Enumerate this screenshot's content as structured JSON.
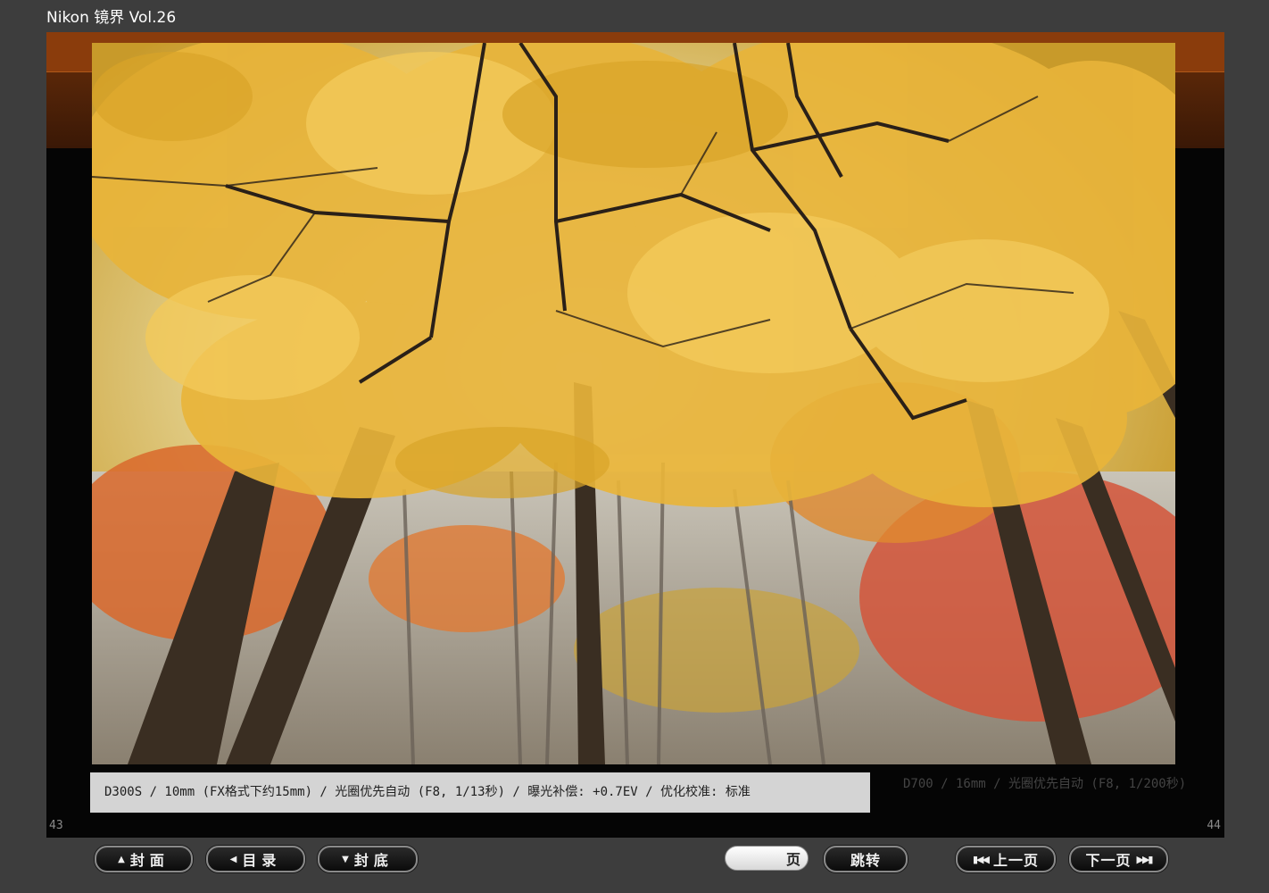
{
  "app": {
    "title": "Nikon 镜界 Vol.26"
  },
  "pages": {
    "left_number": "43",
    "right_number": "44"
  },
  "photo": {
    "subject": "autumn maple canopy",
    "caption": "D300S / 10mm (FX格式下约15mm) / 光圈优先自动 (F8, 1/13秒) / 曝光补偿: +0.7EV / 优化校准: 标准"
  },
  "background_text": {
    "caption_fragment": "D700 / 16mm / 光圈优先自动 (F8, 1/200秒)"
  },
  "toolbar": {
    "cover_label": "封面",
    "toc_label": "目录",
    "back_cover_label": "封底",
    "page_input_value": "",
    "page_suffix": "页",
    "jump_label": "跳转",
    "prev_label": "上一页",
    "next_label": "下一页"
  },
  "icons": {
    "cover": "triangle-up-icon",
    "toc": "triangle-left-icon",
    "back_cover": "triangle-down-icon",
    "prev": "skip-back-icon",
    "next": "skip-forward-icon"
  },
  "colors": {
    "page_bg": "#3d3d3d",
    "reader_bg": "#050505",
    "caption_bg": "#d4d4d4",
    "accent_band": "#8a3c0c"
  }
}
